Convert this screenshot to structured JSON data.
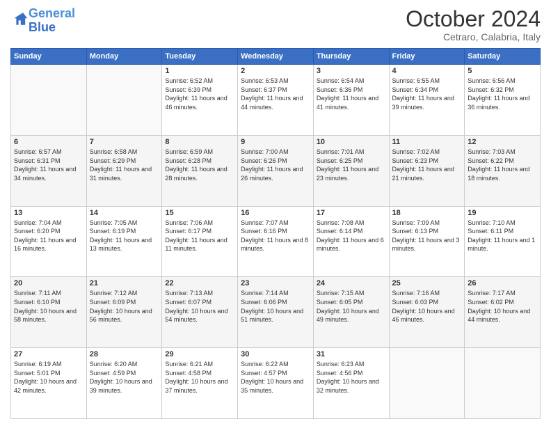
{
  "header": {
    "logo_line1": "General",
    "logo_line2": "Blue",
    "month": "October 2024",
    "location": "Cetraro, Calabria, Italy"
  },
  "weekdays": [
    "Sunday",
    "Monday",
    "Tuesday",
    "Wednesday",
    "Thursday",
    "Friday",
    "Saturday"
  ],
  "weeks": [
    [
      {
        "day": "",
        "info": ""
      },
      {
        "day": "",
        "info": ""
      },
      {
        "day": "1",
        "info": "Sunrise: 6:52 AM\nSunset: 6:39 PM\nDaylight: 11 hours and 46 minutes."
      },
      {
        "day": "2",
        "info": "Sunrise: 6:53 AM\nSunset: 6:37 PM\nDaylight: 11 hours and 44 minutes."
      },
      {
        "day": "3",
        "info": "Sunrise: 6:54 AM\nSunset: 6:36 PM\nDaylight: 11 hours and 41 minutes."
      },
      {
        "day": "4",
        "info": "Sunrise: 6:55 AM\nSunset: 6:34 PM\nDaylight: 11 hours and 39 minutes."
      },
      {
        "day": "5",
        "info": "Sunrise: 6:56 AM\nSunset: 6:32 PM\nDaylight: 11 hours and 36 minutes."
      }
    ],
    [
      {
        "day": "6",
        "info": "Sunrise: 6:57 AM\nSunset: 6:31 PM\nDaylight: 11 hours and 34 minutes."
      },
      {
        "day": "7",
        "info": "Sunrise: 6:58 AM\nSunset: 6:29 PM\nDaylight: 11 hours and 31 minutes."
      },
      {
        "day": "8",
        "info": "Sunrise: 6:59 AM\nSunset: 6:28 PM\nDaylight: 11 hours and 28 minutes."
      },
      {
        "day": "9",
        "info": "Sunrise: 7:00 AM\nSunset: 6:26 PM\nDaylight: 11 hours and 26 minutes."
      },
      {
        "day": "10",
        "info": "Sunrise: 7:01 AM\nSunset: 6:25 PM\nDaylight: 11 hours and 23 minutes."
      },
      {
        "day": "11",
        "info": "Sunrise: 7:02 AM\nSunset: 6:23 PM\nDaylight: 11 hours and 21 minutes."
      },
      {
        "day": "12",
        "info": "Sunrise: 7:03 AM\nSunset: 6:22 PM\nDaylight: 11 hours and 18 minutes."
      }
    ],
    [
      {
        "day": "13",
        "info": "Sunrise: 7:04 AM\nSunset: 6:20 PM\nDaylight: 11 hours and 16 minutes."
      },
      {
        "day": "14",
        "info": "Sunrise: 7:05 AM\nSunset: 6:19 PM\nDaylight: 11 hours and 13 minutes."
      },
      {
        "day": "15",
        "info": "Sunrise: 7:06 AM\nSunset: 6:17 PM\nDaylight: 11 hours and 11 minutes."
      },
      {
        "day": "16",
        "info": "Sunrise: 7:07 AM\nSunset: 6:16 PM\nDaylight: 11 hours and 8 minutes."
      },
      {
        "day": "17",
        "info": "Sunrise: 7:08 AM\nSunset: 6:14 PM\nDaylight: 11 hours and 6 minutes."
      },
      {
        "day": "18",
        "info": "Sunrise: 7:09 AM\nSunset: 6:13 PM\nDaylight: 11 hours and 3 minutes."
      },
      {
        "day": "19",
        "info": "Sunrise: 7:10 AM\nSunset: 6:11 PM\nDaylight: 11 hours and 1 minute."
      }
    ],
    [
      {
        "day": "20",
        "info": "Sunrise: 7:11 AM\nSunset: 6:10 PM\nDaylight: 10 hours and 58 minutes."
      },
      {
        "day": "21",
        "info": "Sunrise: 7:12 AM\nSunset: 6:09 PM\nDaylight: 10 hours and 56 minutes."
      },
      {
        "day": "22",
        "info": "Sunrise: 7:13 AM\nSunset: 6:07 PM\nDaylight: 10 hours and 54 minutes."
      },
      {
        "day": "23",
        "info": "Sunrise: 7:14 AM\nSunset: 6:06 PM\nDaylight: 10 hours and 51 minutes."
      },
      {
        "day": "24",
        "info": "Sunrise: 7:15 AM\nSunset: 6:05 PM\nDaylight: 10 hours and 49 minutes."
      },
      {
        "day": "25",
        "info": "Sunrise: 7:16 AM\nSunset: 6:03 PM\nDaylight: 10 hours and 46 minutes."
      },
      {
        "day": "26",
        "info": "Sunrise: 7:17 AM\nSunset: 6:02 PM\nDaylight: 10 hours and 44 minutes."
      }
    ],
    [
      {
        "day": "27",
        "info": "Sunrise: 6:19 AM\nSunset: 5:01 PM\nDaylight: 10 hours and 42 minutes."
      },
      {
        "day": "28",
        "info": "Sunrise: 6:20 AM\nSunset: 4:59 PM\nDaylight: 10 hours and 39 minutes."
      },
      {
        "day": "29",
        "info": "Sunrise: 6:21 AM\nSunset: 4:58 PM\nDaylight: 10 hours and 37 minutes."
      },
      {
        "day": "30",
        "info": "Sunrise: 6:22 AM\nSunset: 4:57 PM\nDaylight: 10 hours and 35 minutes."
      },
      {
        "day": "31",
        "info": "Sunrise: 6:23 AM\nSunset: 4:56 PM\nDaylight: 10 hours and 32 minutes."
      },
      {
        "day": "",
        "info": ""
      },
      {
        "day": "",
        "info": ""
      }
    ]
  ]
}
